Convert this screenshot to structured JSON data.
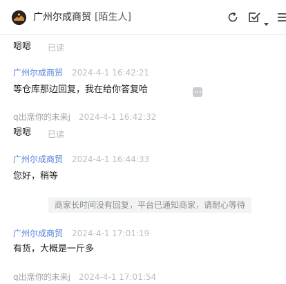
{
  "header": {
    "contact_name": "广州尔成商贸",
    "contact_tag": "[陌生人]",
    "icons": [
      "avatar-logo",
      "refresh-icon",
      "check-square-icon",
      "chevron-down-icon",
      "menu-icon"
    ]
  },
  "messages": [
    {
      "text": "嗯嗯",
      "status": "已读"
    },
    {
      "sender": "广州尔成商贸",
      "time": "2024-4-1 16:42:21",
      "text": "等仓库那边回复，我在给你答复哈"
    },
    {
      "sender": "q出席你的未来j",
      "time": "2024-4-1 16:42:32",
      "text": "嗯嗯",
      "status": "已读"
    },
    {
      "sender": "广州尔成商贸",
      "time": "2024-4-1 16:44:33",
      "text": "您好，稍等"
    },
    {
      "sender": "广州尔成商贸",
      "time": "2024-4-1 17:01:19",
      "text": "有货，大概是一斤多"
    },
    {
      "sender": "q出席你的未来j",
      "time": "2024-4-1 17:01:54"
    }
  ],
  "system_notice": "商家长时间没有回复，平台已通知商家，请耐心等待",
  "colors": {
    "seller_name": "#4e7ed9",
    "buyer_name": "#a2a2a2",
    "timestamp": "#bdbdbd",
    "notice_bg": "#f2f3f5"
  }
}
